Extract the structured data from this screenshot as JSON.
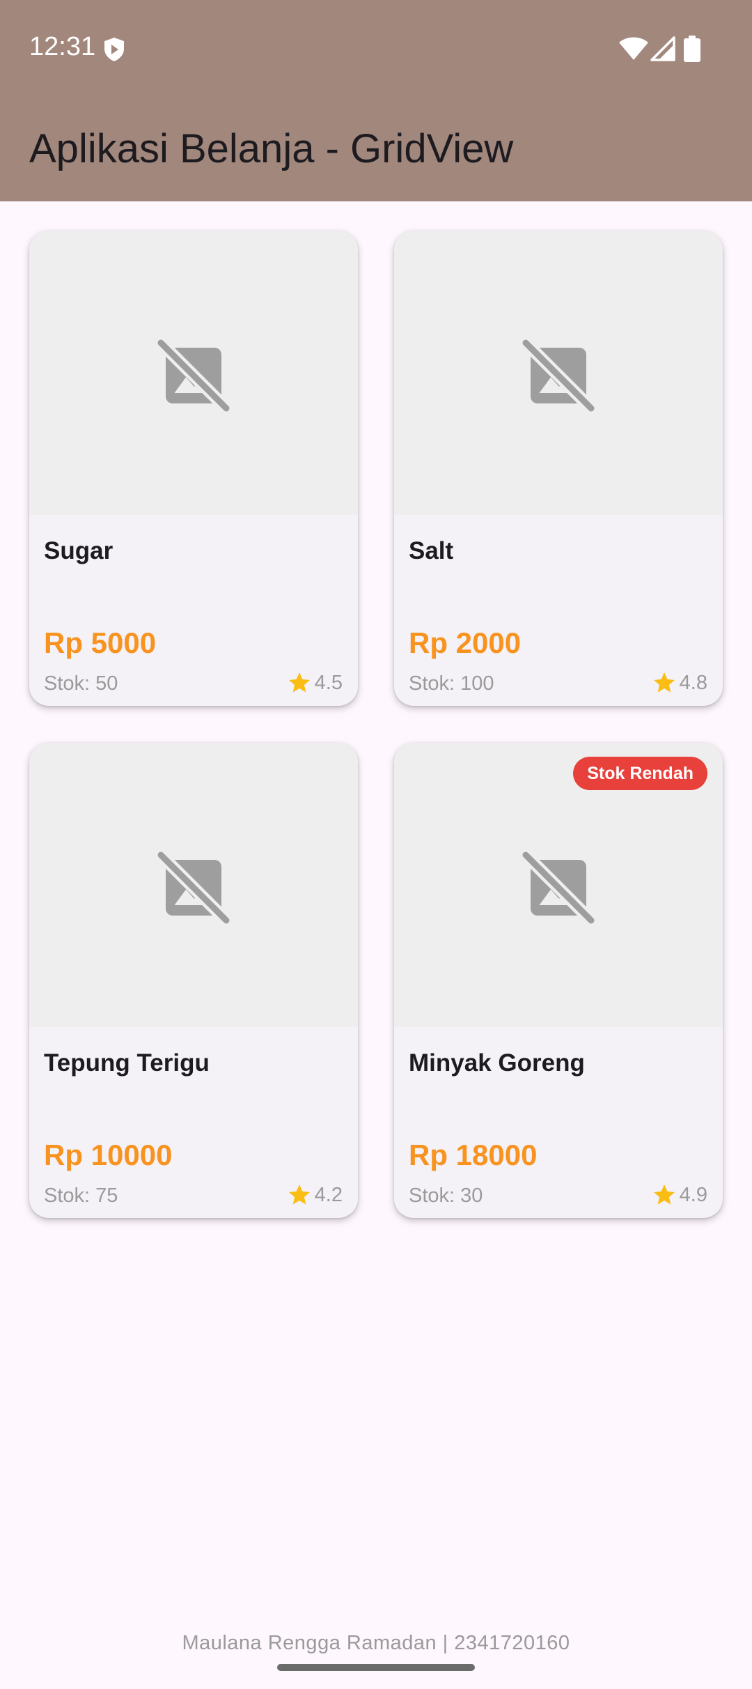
{
  "status_bar": {
    "time": "12:31"
  },
  "app_bar": {
    "title": "Aplikasi Belanja - GridView",
    "color": "#a1877c"
  },
  "products": [
    {
      "name": "Sugar",
      "price": "Rp 5000",
      "stock": "Stok: 50",
      "rating": "4.5",
      "badge": ""
    },
    {
      "name": "Salt",
      "price": "Rp 2000",
      "stock": "Stok: 100",
      "rating": "4.8",
      "badge": ""
    },
    {
      "name": "Tepung Terigu",
      "price": "Rp 10000",
      "stock": "Stok: 75",
      "rating": "4.2",
      "badge": ""
    },
    {
      "name": "Minyak Goreng",
      "price": "Rp 18000",
      "stock": "Stok: 30",
      "rating": "4.9",
      "badge": "Stok Rendah"
    }
  ],
  "footer": {
    "text": "Maulana Rengga Ramadan | 2341720160"
  },
  "colors": {
    "price": "#f7931e",
    "badge": "#e8403a",
    "star": "#f9bd14",
    "background": "#fef7fe"
  }
}
